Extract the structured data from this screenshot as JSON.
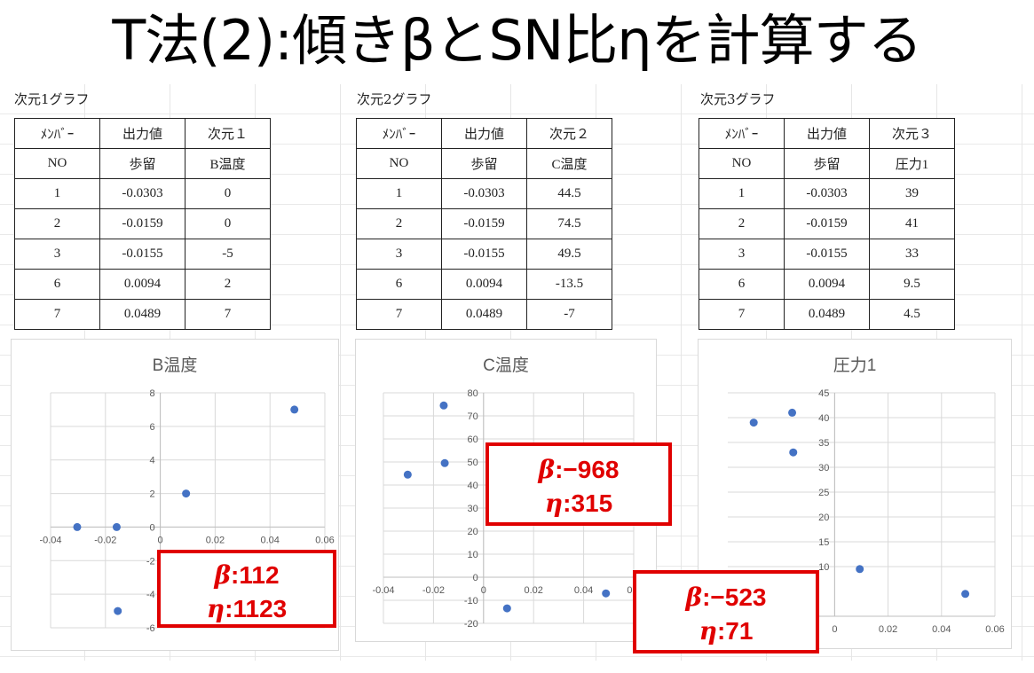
{
  "title": "T法(2):傾きβとSN比ηを計算する",
  "tables": [
    {
      "caption": "次元1グラフ",
      "header1": [
        "ﾒﾝﾊﾞｰ",
        "出力値",
        "次元１"
      ],
      "header2": [
        "NO",
        "歩留",
        "B温度"
      ],
      "rows": [
        [
          "1",
          "-0.0303",
          "0"
        ],
        [
          "2",
          "-0.0159",
          "0"
        ],
        [
          "3",
          "-0.0155",
          "-5"
        ],
        [
          "6",
          "0.0094",
          "2"
        ],
        [
          "7",
          "0.0489",
          "7"
        ]
      ]
    },
    {
      "caption": "次元2グラフ",
      "header1": [
        "ﾒﾝﾊﾞｰ",
        "出力値",
        "次元２"
      ],
      "header2": [
        "NO",
        "歩留",
        "C温度"
      ],
      "rows": [
        [
          "1",
          "-0.0303",
          "44.5"
        ],
        [
          "2",
          "-0.0159",
          "74.5"
        ],
        [
          "3",
          "-0.0155",
          "49.5"
        ],
        [
          "6",
          "0.0094",
          "-13.5"
        ],
        [
          "7",
          "0.0489",
          "-7"
        ]
      ]
    },
    {
      "caption": "次元3グラフ",
      "header1": [
        "ﾒﾝﾊﾞｰ",
        "出力値",
        "次元３"
      ],
      "header2": [
        "NO",
        "歩留",
        "圧力1"
      ],
      "rows": [
        [
          "1",
          "-0.0303",
          "39"
        ],
        [
          "2",
          "-0.0159",
          "41"
        ],
        [
          "3",
          "-0.0155",
          "33"
        ],
        [
          "6",
          "0.0094",
          "9.5"
        ],
        [
          "7",
          "0.0489",
          "4.5"
        ]
      ]
    }
  ],
  "chart_data": [
    {
      "type": "scatter",
      "title": "B温度",
      "x": [
        -0.0303,
        -0.0159,
        -0.0155,
        0.0094,
        0.0489
      ],
      "y": [
        0,
        0,
        -5,
        2,
        7
      ],
      "xlim": [
        -0.04,
        0.06
      ],
      "ylim": [
        -6,
        8
      ],
      "xticks": [
        -0.04,
        -0.02,
        0,
        0.02,
        0.04,
        0.06
      ],
      "yticks": [
        -6,
        -4,
        -2,
        0,
        2,
        4,
        6,
        8
      ],
      "xtick_labels": [
        "-0.04",
        "-0.02",
        "0",
        "0.02",
        "0.04",
        "0.06"
      ],
      "ytick_labels": [
        "-6",
        "-4",
        "-2",
        "0",
        "2",
        "4",
        "6",
        "8"
      ],
      "marker_color": "#4472c4",
      "grid": true
    },
    {
      "type": "scatter",
      "title": "C温度",
      "x": [
        -0.0303,
        -0.0159,
        -0.0155,
        0.0094,
        0.0489
      ],
      "y": [
        44.5,
        74.5,
        49.5,
        -13.5,
        -7
      ],
      "xlim": [
        -0.04,
        0.06
      ],
      "ylim": [
        -20,
        80
      ],
      "xticks": [
        -0.04,
        -0.02,
        0,
        0.02,
        0.04,
        0.06
      ],
      "yticks": [
        -20,
        -10,
        0,
        10,
        20,
        30,
        40,
        50,
        60,
        70,
        80
      ],
      "xtick_labels": [
        "-0.04",
        "-0.02",
        "0",
        "0.02",
        "0.04",
        "0.0"
      ],
      "ytick_labels": [
        "-20",
        "-10",
        "0",
        "10",
        "20",
        "30",
        "40",
        "50",
        "60",
        "70",
        "80"
      ],
      "marker_color": "#4472c4",
      "grid": true
    },
    {
      "type": "scatter",
      "title": "圧力1",
      "x": [
        -0.0303,
        -0.0159,
        -0.0155,
        0.0094,
        0.0489
      ],
      "y": [
        39,
        41,
        33,
        9.5,
        4.5
      ],
      "xlim": [
        -0.04,
        0.06
      ],
      "ylim": [
        0,
        45
      ],
      "xticks": [
        0,
        0.02,
        0.04,
        0.06
      ],
      "yticks": [
        10,
        15,
        20,
        25,
        30,
        35,
        40,
        45
      ],
      "xtick_labels": [
        "0",
        "0.02",
        "0.04",
        "0.06"
      ],
      "ytick_labels": [
        "10",
        "15",
        "20",
        "25",
        "30",
        "35",
        "40",
        "45"
      ],
      "marker_color": "#4472c4",
      "grid": true
    }
  ],
  "results": [
    {
      "beta_symbol": "β",
      "beta": ":112",
      "eta_symbol": "η",
      "eta": ":1123"
    },
    {
      "beta_symbol": "β",
      "beta": ":−968",
      "eta_symbol": "η",
      "eta": ":315"
    },
    {
      "beta_symbol": "β",
      "beta": ":−523",
      "eta_symbol": "η",
      "eta": ":71"
    }
  ],
  "accent_color": "#e00000"
}
